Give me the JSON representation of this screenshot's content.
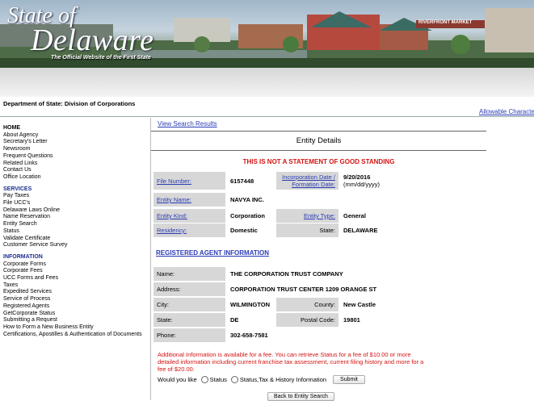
{
  "banner": {
    "logo_state": "State of",
    "logo_delaware": "Delaware",
    "tagline": "The Official Website of the First State",
    "sign_text": "RIVERFRONT MARKET"
  },
  "header": {
    "department": "Department of State: Division of Corporations",
    "allowable_link": "Allowable Characte"
  },
  "sidebar": {
    "home": "HOME",
    "home_items": [
      "About Agency",
      "Secretary's Letter",
      "Newsroom",
      "Frequent Questions",
      "Related Links",
      "Contact Us",
      "Office Location"
    ],
    "services": "SERVICES",
    "services_items": [
      "Pay Taxes",
      "File UCC's",
      "Delaware Laws Online",
      "Name Reservation",
      "Entity Search",
      "Status",
      "Validate Certificate",
      "Customer Service Survey"
    ],
    "information": "INFORMATION",
    "information_items": [
      "Corporate Forms",
      "Corporate Fees",
      "UCC Forms and Fees",
      "Taxes",
      "Expedited Services",
      "Service of Process",
      "Registered Agents",
      "GetCorporate Status",
      "Submitting a Request",
      "How to Form a New Business Entity",
      "Certifications, Apostilles & Authentication of Documents"
    ]
  },
  "main": {
    "view_search_results": "View Search Results",
    "title": "Entity Details",
    "warning": "THIS IS NOT A STATEMENT OF GOOD STANDING",
    "file_number_label": "File Number:",
    "file_number": "6157448",
    "inc_date_label_1": "Incorporation Date /",
    "inc_date_label_2": "Formation Date:",
    "inc_date": "9/20/2016",
    "inc_date_format": "(mm/dd/yyyy)",
    "entity_name_label": "Entity Name:",
    "entity_name": "NAVYA INC.",
    "entity_kind_label": "Entity Kind:",
    "entity_kind": "Corporation",
    "entity_type_label": "Entity Type:",
    "entity_type": "General",
    "residency_label": "Residency:",
    "residency": "Domestic",
    "state_label": "State:",
    "state": "DELAWARE",
    "registered_agent_heading": "REGISTERED AGENT INFORMATION",
    "ra_name_label": "Name:",
    "ra_name": "THE CORPORATION TRUST COMPANY",
    "ra_address_label": "Address:",
    "ra_address": "CORPORATION TRUST CENTER 1209 ORANGE ST",
    "ra_city_label": "City:",
    "ra_city": "WILMINGTON",
    "ra_county_label": "County:",
    "ra_county": "New Castle",
    "ra_state_label": "State:",
    "ra_state": "DE",
    "ra_postal_label": "Postal Code:",
    "ra_postal": "19801",
    "ra_phone_label": "Phone:",
    "ra_phone": "302-658-7581",
    "additional_info": "Additional Information is available for a fee. You can retrieve Status for a fee of $10.00 or more detailed information including current franchise tax assessment, current filing history and more for a fee of $20.00.",
    "would_you_like": "Would you like",
    "option_status": "Status",
    "option_status_tax": "Status,Tax & History Information",
    "submit": "Submit",
    "back_button": "Back to Entity Search"
  }
}
